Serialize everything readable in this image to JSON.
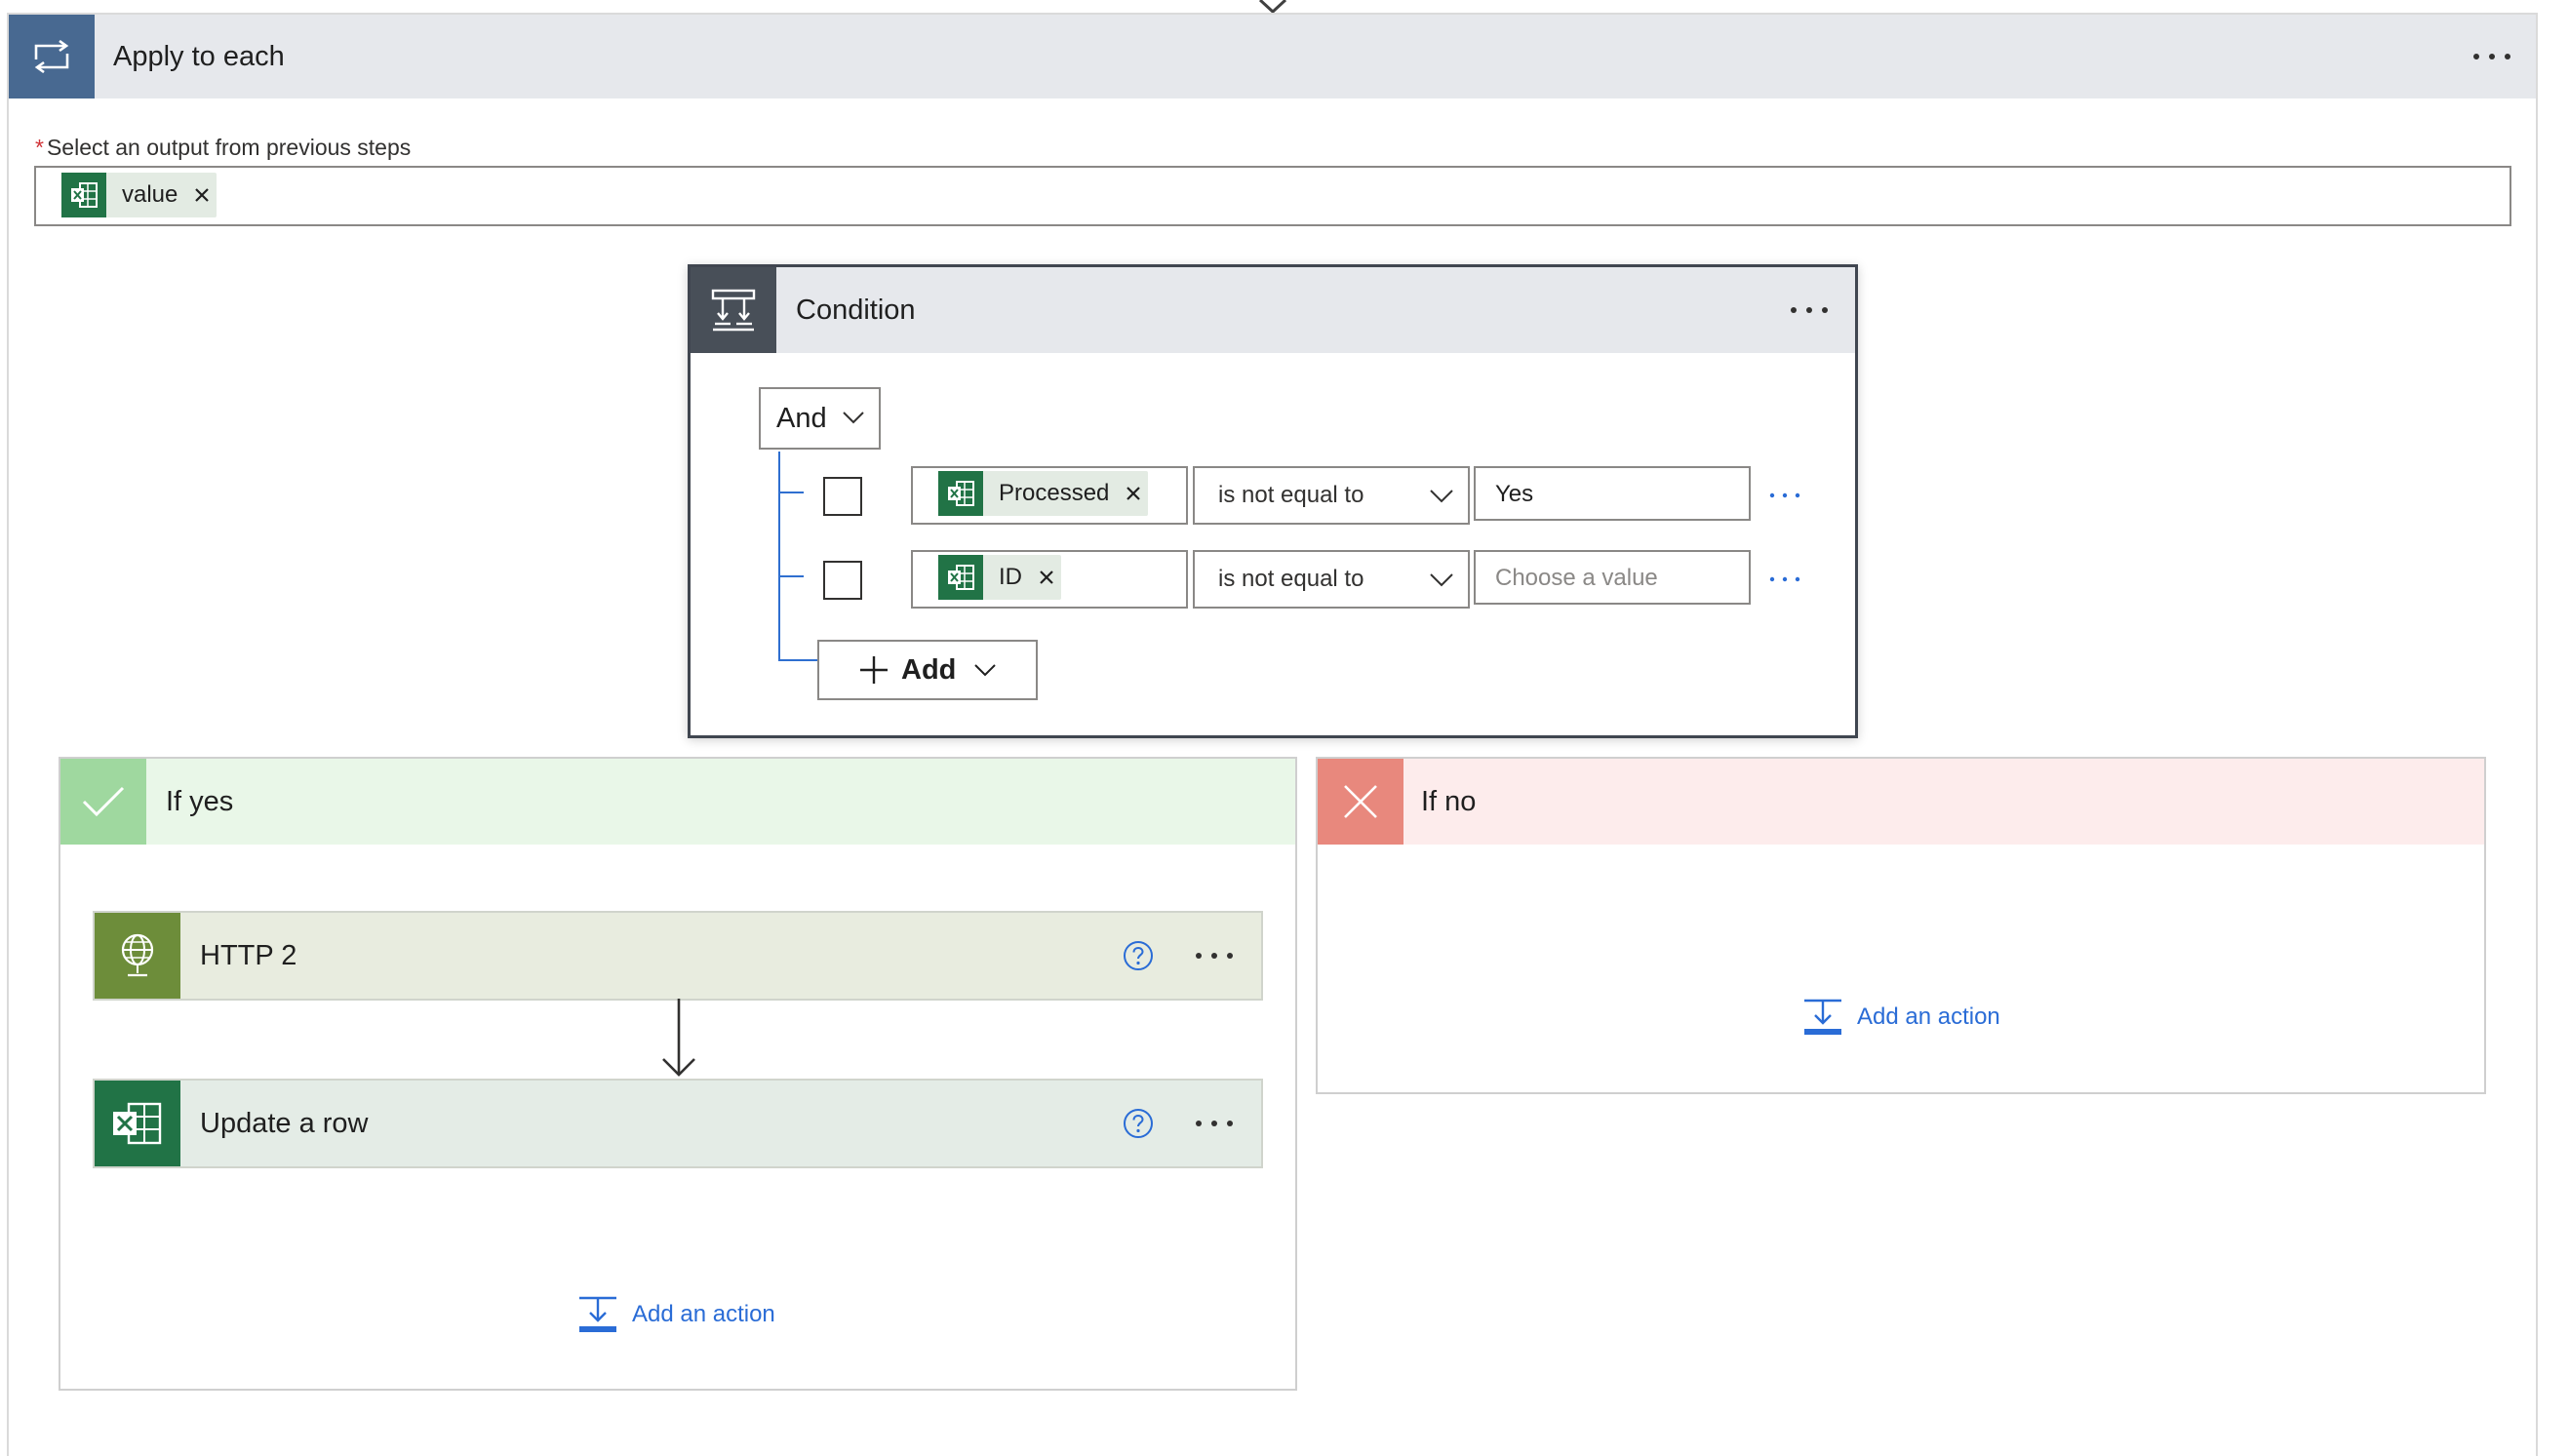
{
  "apply_to_each": {
    "title": "Apply to each",
    "select_label": "Select an output from previous steps",
    "required_marker": "*",
    "token": {
      "label": "value",
      "icon": "excel-icon"
    }
  },
  "condition": {
    "title": "Condition",
    "group_operator": "And",
    "rows": [
      {
        "left_token": "Processed",
        "operator": "is not equal to",
        "value": "Yes",
        "value_placeholder": ""
      },
      {
        "left_token": "ID",
        "operator": "is not equal to",
        "value": "",
        "value_placeholder": "Choose a value"
      }
    ],
    "add_label": "Add"
  },
  "if_yes": {
    "title": "If yes",
    "actions": [
      {
        "title": "HTTP 2",
        "icon": "globe-icon"
      },
      {
        "title": "Update a row",
        "icon": "excel-icon"
      }
    ],
    "add_action_label": "Add an action"
  },
  "if_no": {
    "title": "If no",
    "add_action_label": "Add an action"
  },
  "colors": {
    "apply_header_icon": "#486991",
    "condition_icon": "#484f58",
    "yes_icon": "#9fd89f",
    "no_icon": "#e8887d",
    "http_icon": "#6d8d3a",
    "excel": "#217346",
    "link": "#2a6cd6"
  }
}
